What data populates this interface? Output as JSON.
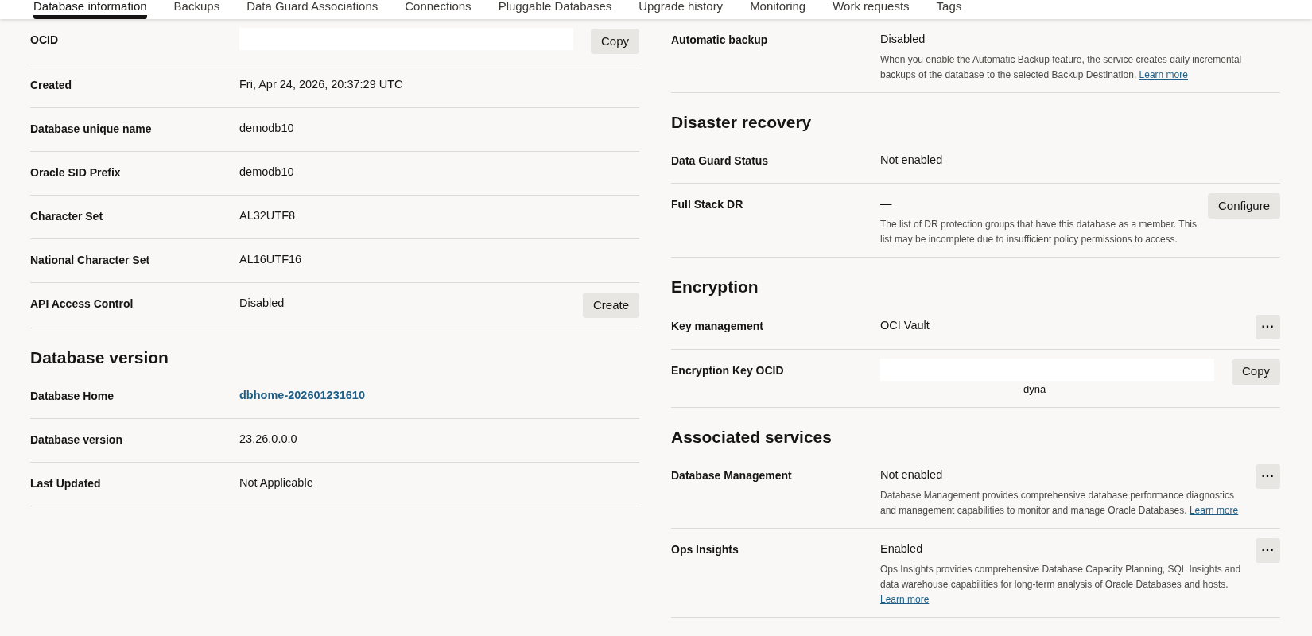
{
  "tabs": [
    {
      "label": "Database information",
      "selected": true
    },
    {
      "label": "Backups",
      "selected": false
    },
    {
      "label": "Data Guard Associations",
      "selected": false
    },
    {
      "label": "Connections",
      "selected": false
    },
    {
      "label": "Pluggable Databases",
      "selected": false
    },
    {
      "label": "Upgrade history",
      "selected": false
    },
    {
      "label": "Monitoring",
      "selected": false
    },
    {
      "label": "Work requests",
      "selected": false
    },
    {
      "label": "Tags",
      "selected": false
    }
  ],
  "left_sections": [
    {
      "rows": [
        {
          "label": "OCID",
          "kind": "redacted",
          "action": {
            "kind": "button",
            "label": "Copy"
          }
        },
        {
          "label": "Created",
          "value": "Fri, Apr 24, 2026, 20:37:29 UTC",
          "kind": "text"
        },
        {
          "label": "Database unique name",
          "value": "demodb10",
          "kind": "text"
        },
        {
          "label": "Oracle SID Prefix",
          "value": "demodb10",
          "kind": "text"
        },
        {
          "label": "Character Set",
          "value": "AL32UTF8",
          "kind": "text"
        },
        {
          "label": "National Character Set",
          "value": "AL16UTF16",
          "kind": "text"
        },
        {
          "label": "API Access Control",
          "value": "Disabled",
          "kind": "text",
          "action": {
            "kind": "button",
            "label": "Create"
          }
        }
      ]
    },
    {
      "title": "Database version",
      "rows": [
        {
          "label": "Database Home",
          "value": "dbhome-202601231610",
          "kind": "link"
        },
        {
          "label": "Database version",
          "value": "23.26.0.0.0",
          "kind": "text"
        },
        {
          "label": "Last Updated",
          "value": "Not Applicable",
          "kind": "text"
        }
      ]
    }
  ],
  "right_sections": [
    {
      "rows": [
        {
          "label": "Automatic backup",
          "value": "Disabled",
          "kind": "text",
          "description": "When you enable the Automatic Backup feature, the service creates daily incremental backups of the database to the selected Backup Destination.",
          "description_link": "Learn more"
        }
      ]
    },
    {
      "title": "Disaster recovery",
      "rows": [
        {
          "label": "Data Guard Status",
          "value": "Not enabled",
          "kind": "text"
        },
        {
          "label": "Full Stack DR",
          "value": "—",
          "kind": "text",
          "description": "The list of DR protection groups that have this database as a member. This list may be incomplete due to insufficient policy permissions to access.",
          "action": {
            "kind": "button",
            "label": "Configure"
          }
        }
      ]
    },
    {
      "title": "Encryption",
      "rows": [
        {
          "label": "Key management",
          "value": "OCI Vault",
          "kind": "text",
          "action": {
            "kind": "menu",
            "label": "···"
          }
        },
        {
          "label": "Encryption Key OCID",
          "value": "dyna",
          "kind": "redacted",
          "action": {
            "kind": "button",
            "label": "Copy"
          }
        }
      ]
    },
    {
      "title": "Associated services",
      "rows": [
        {
          "label": "Database Management",
          "value": "Not enabled",
          "kind": "text",
          "description": "Database Management provides comprehensive database performance diagnostics and management capabilities to monitor and manage Oracle Databases.",
          "description_link": "Learn more",
          "action": {
            "kind": "menu",
            "label": "···"
          }
        },
        {
          "label": "Ops Insights",
          "value": "Enabled",
          "kind": "text",
          "description": "Ops Insights provides comprehensive Database Capacity Planning, SQL Insights and data warehouse capabilities for long-term analysis of Oracle Databases and hosts.",
          "description_link": "Learn more",
          "action": {
            "kind": "menu",
            "label": "···"
          }
        }
      ]
    }
  ]
}
